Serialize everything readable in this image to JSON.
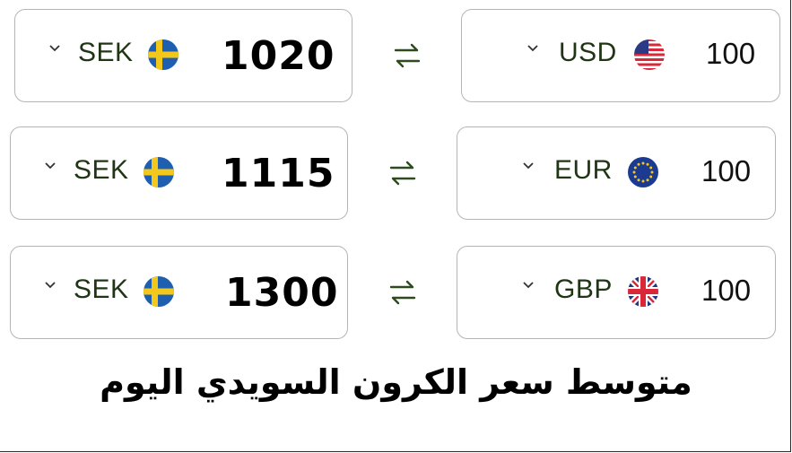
{
  "rows": [
    {
      "left": {
        "currency": "SEK",
        "flag": "sweden-flag",
        "amount": "1020"
      },
      "swap_icon": "swap-arrows-icon",
      "right": {
        "currency": "USD",
        "flag": "usa-flag",
        "amount": "100"
      }
    },
    {
      "left": {
        "currency": "SEK",
        "flag": "sweden-flag",
        "amount": "1115"
      },
      "swap_icon": "swap-arrows-icon",
      "right": {
        "currency": "EUR",
        "flag": "eu-flag",
        "amount": "100"
      }
    },
    {
      "left": {
        "currency": "SEK",
        "flag": "sweden-flag",
        "amount": "1300"
      },
      "swap_icon": "swap-arrows-icon",
      "right": {
        "currency": "GBP",
        "flag": "uk-flag",
        "amount": "100"
      }
    }
  ],
  "caption": "متوسط سعر  الكرون السويدي اليوم",
  "colors": {
    "code_text": "#1f3514",
    "box_border": "#b5b5b5",
    "swap_arrows": "#2e4a1e"
  }
}
